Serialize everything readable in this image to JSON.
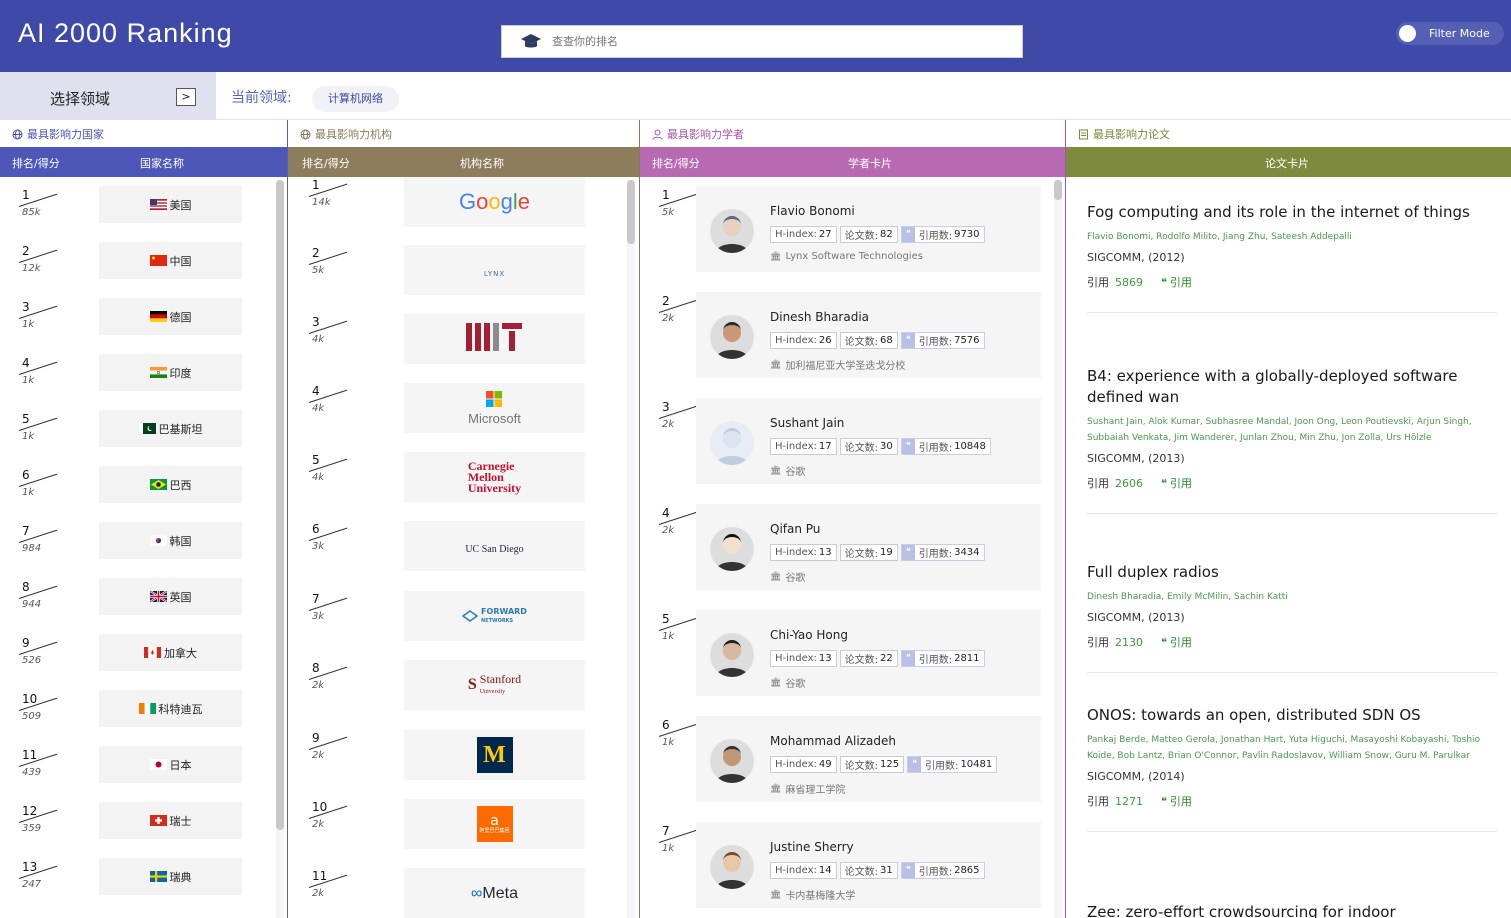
{
  "header": {
    "title": "AI 2000 Ranking",
    "search_placeholder": "查查你的排名",
    "filter_label": "Filter Mode"
  },
  "field_bar": {
    "select_label": "选择领域",
    "select_arrow": ">",
    "current_label": "当前领域:",
    "current_value": "计算机网络"
  },
  "countries": {
    "title": "最具影响力国家",
    "col_rank": "排名/得分",
    "col_name": "国家名称",
    "items": [
      {
        "rank": "1",
        "score": "85k",
        "name": "美国",
        "flag": "us"
      },
      {
        "rank": "2",
        "score": "12k",
        "name": "中国",
        "flag": "cn"
      },
      {
        "rank": "3",
        "score": "1k",
        "name": "德国",
        "flag": "de"
      },
      {
        "rank": "4",
        "score": "1k",
        "name": "印度",
        "flag": "in"
      },
      {
        "rank": "5",
        "score": "1k",
        "name": "巴基斯坦",
        "flag": "pk"
      },
      {
        "rank": "6",
        "score": "1k",
        "name": "巴西",
        "flag": "br"
      },
      {
        "rank": "7",
        "score": "984",
        "name": "韩国",
        "flag": "kr"
      },
      {
        "rank": "8",
        "score": "944",
        "name": "英国",
        "flag": "gb"
      },
      {
        "rank": "9",
        "score": "526",
        "name": "加拿大",
        "flag": "ca"
      },
      {
        "rank": "10",
        "score": "509",
        "name": "科特迪瓦",
        "flag": "ci"
      },
      {
        "rank": "11",
        "score": "439",
        "name": "日本",
        "flag": "jp"
      },
      {
        "rank": "12",
        "score": "359",
        "name": "瑞士",
        "flag": "ch"
      },
      {
        "rank": "13",
        "score": "247",
        "name": "瑞典",
        "flag": "se"
      }
    ]
  },
  "institutions": {
    "title": "最具影响力机构",
    "col_rank": "排名/得分",
    "col_name": "机构名称",
    "items": [
      {
        "rank": "1",
        "score": "14k",
        "logo": "Google"
      },
      {
        "rank": "2",
        "score": "5k",
        "logo": "LYNX"
      },
      {
        "rank": "3",
        "score": "4k",
        "logo": "MIT"
      },
      {
        "rank": "4",
        "score": "4k",
        "logo": "Microsoft"
      },
      {
        "rank": "5",
        "score": "4k",
        "logo": "Carnegie Mellon University"
      },
      {
        "rank": "6",
        "score": "3k",
        "logo": "UC San Diego"
      },
      {
        "rank": "7",
        "score": "3k",
        "logo": "FORWARD NETWORKS"
      },
      {
        "rank": "8",
        "score": "2k",
        "logo": "Stanford University"
      },
      {
        "rank": "9",
        "score": "2k",
        "logo": "M"
      },
      {
        "rank": "10",
        "score": "2k",
        "logo": "阿里巴巴集团"
      },
      {
        "rank": "11",
        "score": "2k",
        "logo": "Meta"
      }
    ]
  },
  "scholars": {
    "title": "最具影响力学者",
    "col_rank": "排名/得分",
    "col_name": "学者卡片",
    "hindex_label": "H-index:",
    "papers_label": "论文数:",
    "cites_label": "引用数:",
    "items": [
      {
        "rank": "1",
        "score": "5k",
        "name": "Flavio Bonomi",
        "hindex": "27",
        "papers": "82",
        "cites": "9730",
        "inst": "Lynx Software Technologies"
      },
      {
        "rank": "2",
        "score": "2k",
        "name": "Dinesh Bharadia",
        "hindex": "26",
        "papers": "68",
        "cites": "7576",
        "inst": "加利福尼亚大学圣迭戈分校"
      },
      {
        "rank": "3",
        "score": "2k",
        "name": "Sushant Jain",
        "hindex": "17",
        "papers": "30",
        "cites": "10848",
        "inst": "谷歌"
      },
      {
        "rank": "4",
        "score": "2k",
        "name": "Qifan Pu",
        "hindex": "13",
        "papers": "19",
        "cites": "3434",
        "inst": "谷歌"
      },
      {
        "rank": "5",
        "score": "1k",
        "name": "Chi-Yao Hong",
        "hindex": "13",
        "papers": "22",
        "cites": "2811",
        "inst": "谷歌"
      },
      {
        "rank": "6",
        "score": "1k",
        "name": "Mohammad Alizadeh",
        "hindex": "49",
        "papers": "125",
        "cites": "10481",
        "inst": "麻省理工学院"
      },
      {
        "rank": "7",
        "score": "1k",
        "name": "Justine Sherry",
        "hindex": "14",
        "papers": "31",
        "cites": "2865",
        "inst": "卡内基梅隆大学"
      }
    ]
  },
  "papers": {
    "title": "最具影响力论文",
    "col_name": "论文卡片",
    "cite_label": "引用",
    "cite_link": "引用",
    "items": [
      {
        "title": "Fog computing and its role in the internet of things",
        "authors": "Flavio Bonomi, Rodolfo Milito, Jiang Zhu, Sateesh Addepalli",
        "venue": "SIGCOMM, (2012)",
        "cites": "5869"
      },
      {
        "title": "B4: experience with a globally-deployed software defined wan",
        "authors": "Sushant Jain, Alok Kumar, Subhasree Mandal, Joon Ong, Leon Poutievski, Arjun Singh, Subbaiah Venkata, Jim Wanderer, Junlan Zhou, Min Zhu, Jon Zolla, Urs Hölzle",
        "venue": "SIGCOMM, (2013)",
        "cites": "2606"
      },
      {
        "title": "Full duplex radios",
        "authors": "Dinesh Bharadia, Emily McMilin, Sachin Katti",
        "venue": "SIGCOMM, (2013)",
        "cites": "2130"
      },
      {
        "title": "ONOS: towards an open, distributed SDN OS",
        "authors": "Pankaj Berde, Matteo Gerola, Jonathan Hart, Yuta Higuchi, Masayoshi Kobayashi, Toshio Koide, Bob Lantz, Brian O'Connor, Pavlin Radoslavov, William Snow, Guru M. Parulkar",
        "venue": "SIGCOMM, (2014)",
        "cites": "1271"
      },
      {
        "title": "Zee: zero-effort crowdsourcing for indoor",
        "authors": "",
        "venue": "",
        "cites": ""
      }
    ]
  }
}
